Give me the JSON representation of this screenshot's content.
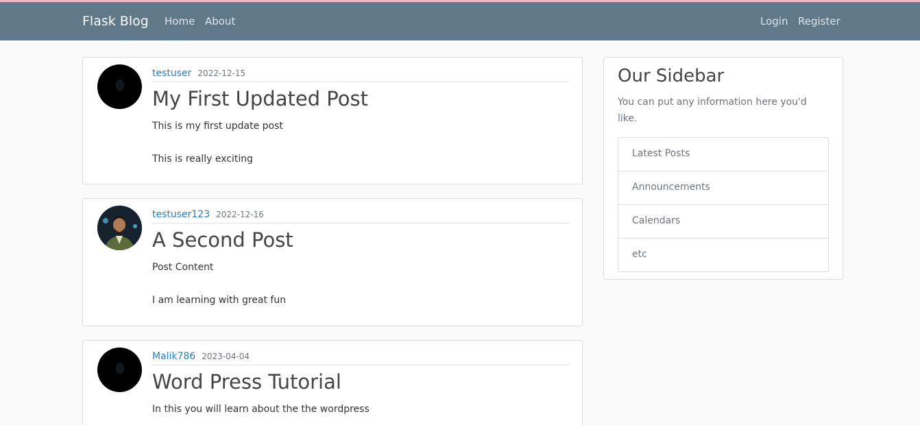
{
  "navbar": {
    "brand": "Flask Blog",
    "links": [
      "Home",
      "About"
    ],
    "auth_links": [
      "Login",
      "Register"
    ],
    "color": "#5f788a"
  },
  "posts": [
    {
      "author": "testuser",
      "date": "2022-12-15",
      "title": "My First Updated Post",
      "content": [
        "This is my first update post",
        "This is really exciting"
      ]
    },
    {
      "author": "testuser123",
      "date": "2022-12-16",
      "title": "A Second Post",
      "content": [
        "Post Content",
        "I am learning with great fun"
      ]
    },
    {
      "author": "Malik786",
      "date": "2023-04-04",
      "title": "Word Press Tutorial",
      "content": [
        "In this you will learn about the the wordpress"
      ]
    }
  ],
  "sidebar": {
    "title": "Our Sidebar",
    "text": "You can put any information here you'd like.",
    "items": [
      "Latest Posts",
      "Announcements",
      "Calendars",
      "etc"
    ]
  }
}
